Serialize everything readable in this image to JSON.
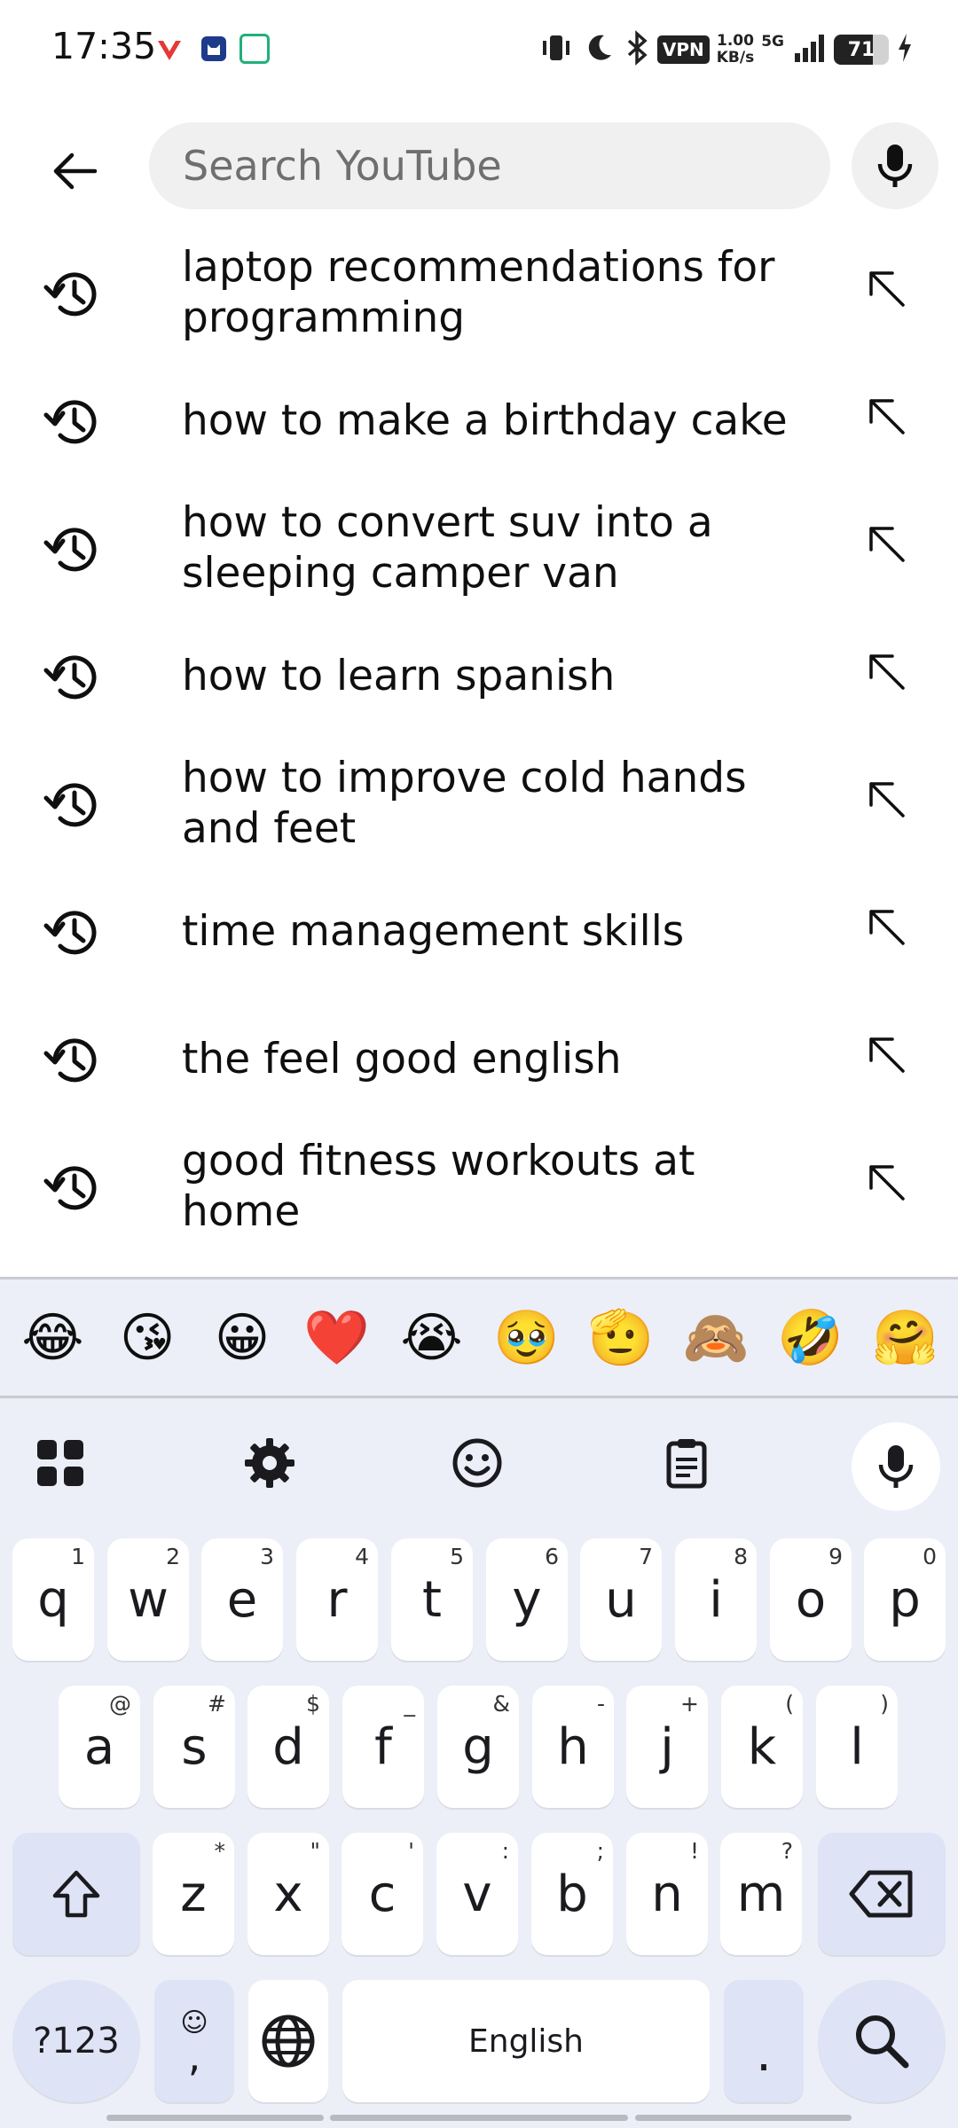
{
  "status_bar": {
    "time": "17:35",
    "vpn": "VPN",
    "speed_value": "1.00",
    "speed_unit": "KB/s",
    "network": "5G",
    "battery": "71",
    "battery_level": 0.71
  },
  "search": {
    "placeholder": "Search YouTube"
  },
  "suggestions": [
    "laptop recommendations for programming",
    "how to make a birthday cake",
    "how to convert suv into a sleeping camper van",
    "how to learn spanish",
    "how to improve cold hands and feet",
    "time management skills",
    "the feel good english",
    "good fitness workouts at home"
  ],
  "keyboard": {
    "emojis": [
      "😂",
      "😘",
      "😀",
      "❤️",
      "😭",
      "🥹",
      "🫡",
      "🙈",
      "🤣",
      "🤗"
    ],
    "row1": [
      {
        "k": "q",
        "h": "1"
      },
      {
        "k": "w",
        "h": "2"
      },
      {
        "k": "e",
        "h": "3"
      },
      {
        "k": "r",
        "h": "4"
      },
      {
        "k": "t",
        "h": "5"
      },
      {
        "k": "y",
        "h": "6"
      },
      {
        "k": "u",
        "h": "7"
      },
      {
        "k": "i",
        "h": "8"
      },
      {
        "k": "o",
        "h": "9"
      },
      {
        "k": "p",
        "h": "0"
      }
    ],
    "row2": [
      {
        "k": "a",
        "h": "@"
      },
      {
        "k": "s",
        "h": "#"
      },
      {
        "k": "d",
        "h": "$"
      },
      {
        "k": "f",
        "h": "_"
      },
      {
        "k": "g",
        "h": "&"
      },
      {
        "k": "h",
        "h": "-"
      },
      {
        "k": "j",
        "h": "+"
      },
      {
        "k": "k",
        "h": "("
      },
      {
        "k": "l",
        "h": ")"
      }
    ],
    "row3": [
      {
        "k": "z",
        "h": "*"
      },
      {
        "k": "x",
        "h": "\""
      },
      {
        "k": "c",
        "h": "'"
      },
      {
        "k": "v",
        "h": ":"
      },
      {
        "k": "b",
        "h": ";"
      },
      {
        "k": "n",
        "h": "!"
      },
      {
        "k": "m",
        "h": "?"
      }
    ],
    "symbols_key": "?123",
    "comma_key": ",",
    "space_label": "English",
    "period_key": "."
  }
}
